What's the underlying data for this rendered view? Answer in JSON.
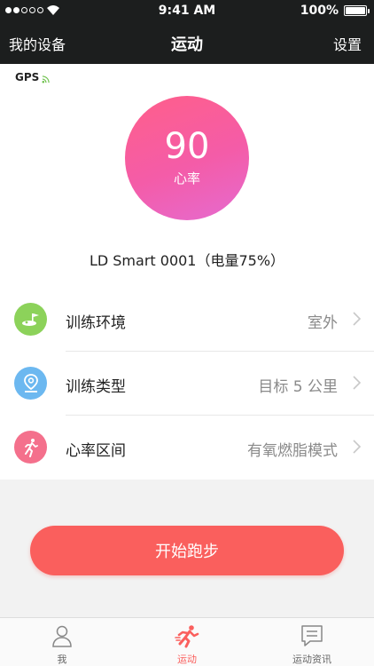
{
  "status_bar": {
    "time": "9:41 AM",
    "battery": "100%"
  },
  "nav": {
    "left": "我的设备",
    "title": "运动",
    "right": "设置"
  },
  "gps": {
    "label": "GPS"
  },
  "heart_rate": {
    "value": "90",
    "label": "心率"
  },
  "device": {
    "name": "LD Smart 0001（电量75%）"
  },
  "settings": [
    {
      "label": "训练环境",
      "value": "室外",
      "icon": "golf-field-icon",
      "color": "#8cd25a"
    },
    {
      "label": "训练类型",
      "value": "目标 5 公里",
      "icon": "location-pin-icon",
      "color": "#6cb8f0"
    },
    {
      "label": "心率区间",
      "value": "有氧燃脂模式",
      "icon": "runner-icon",
      "color": "#f4708c"
    }
  ],
  "start_button": {
    "label": "开始跑步"
  },
  "tabs": [
    {
      "label": "我",
      "icon": "person-icon"
    },
    {
      "label": "运动",
      "icon": "runner-icon"
    },
    {
      "label": "运动资讯",
      "icon": "message-icon"
    }
  ],
  "colors": {
    "accent": "#fa5f5d",
    "header": "#1c1e1e"
  }
}
